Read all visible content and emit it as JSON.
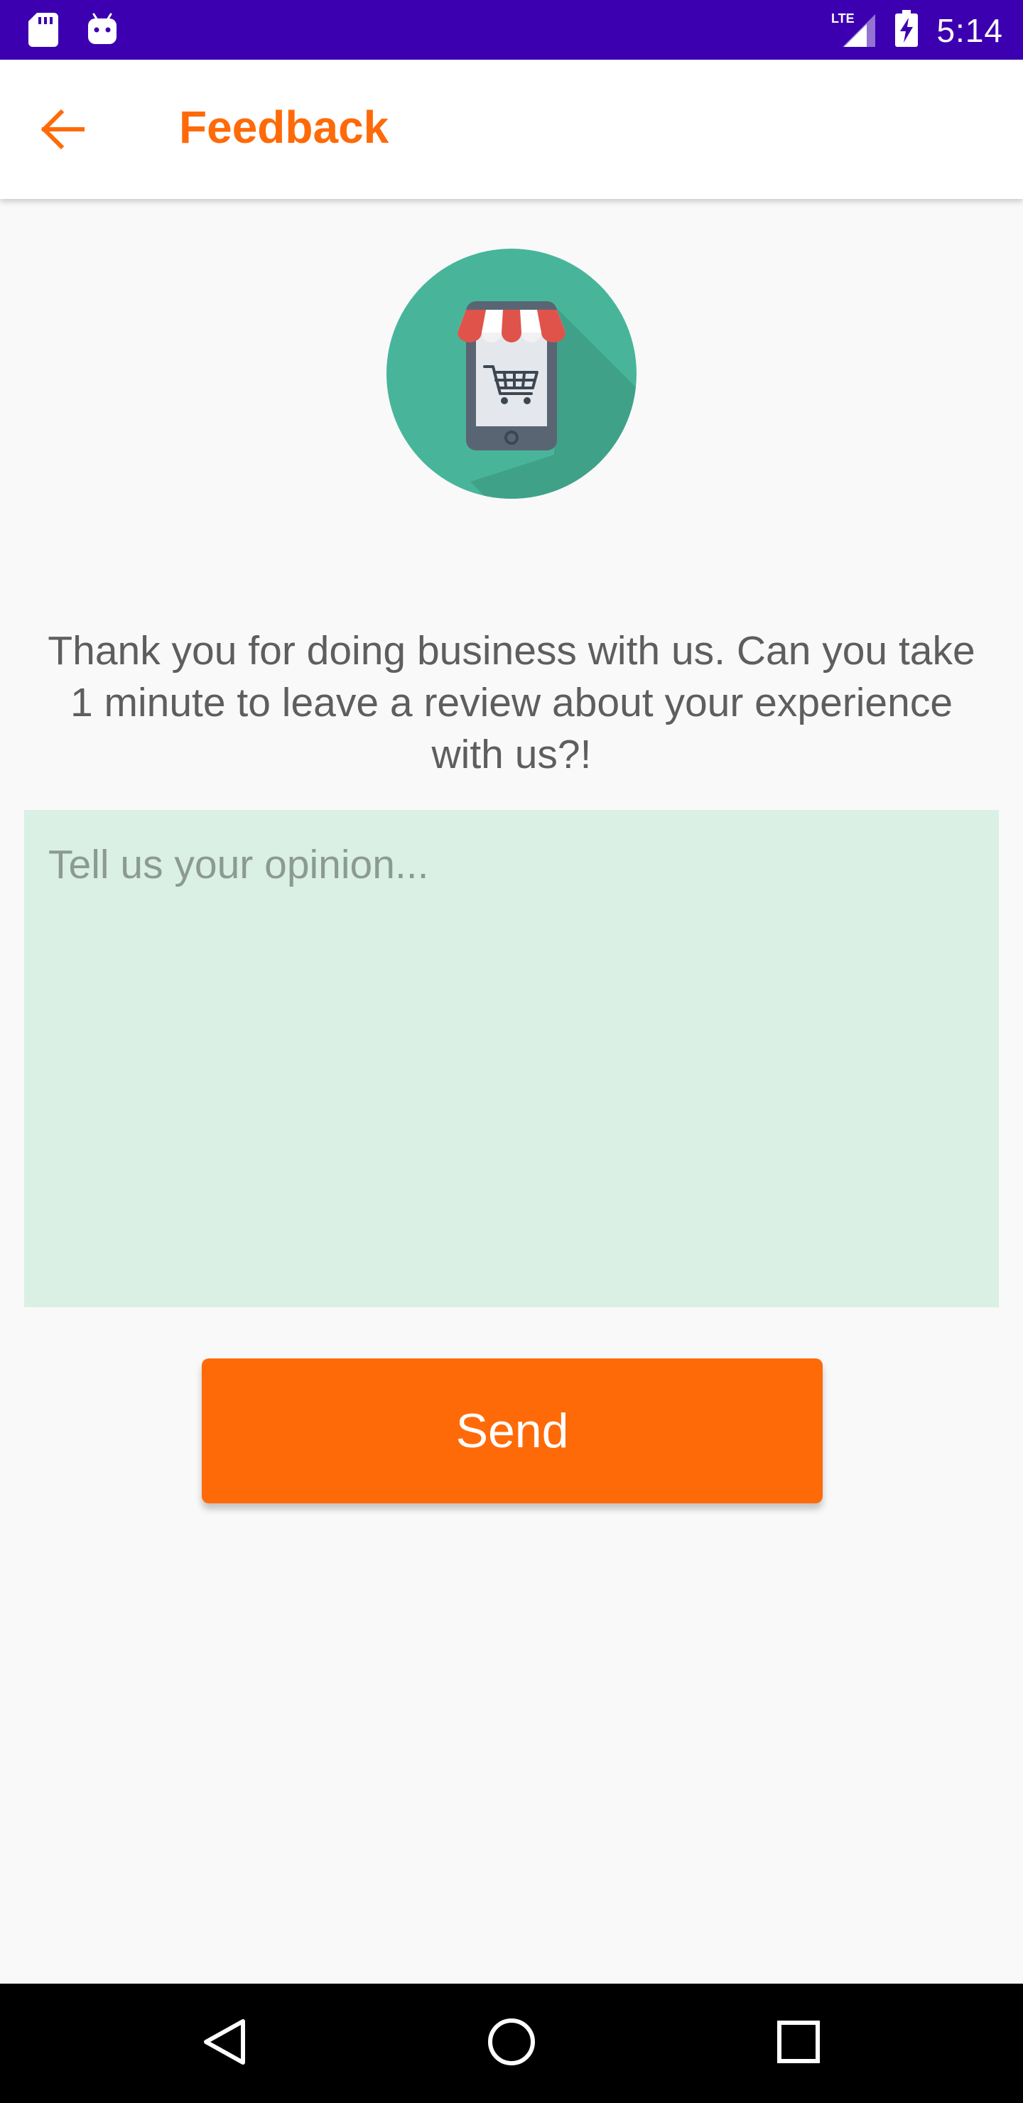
{
  "status_bar": {
    "time": "5:14",
    "network_label": "LTE",
    "icons": [
      "sd-card-icon",
      "android-icon",
      "lte-signal-icon",
      "battery-charging-icon"
    ]
  },
  "app_bar": {
    "title": "Feedback",
    "back_icon": "arrow-left-icon"
  },
  "logo": {
    "icon": "mobile-shop-icon"
  },
  "message": {
    "line1": "Thank you for doing business with us. Can you take",
    "line2": "1 minute to leave a review about your experience",
    "line3": "with us?!"
  },
  "feedback": {
    "placeholder": "Tell us your opinion...",
    "value": ""
  },
  "send_button": {
    "label": "Send"
  },
  "nav_bar": {
    "icons": [
      "back-triangle-icon",
      "home-circle-icon",
      "recents-square-icon"
    ]
  },
  "colors": {
    "status_bar": "#3c00b0",
    "accent": "#ff6a08",
    "input_background": "#daf0e4",
    "logo_circle": "#48b59b",
    "text": "#5e5e5e"
  }
}
